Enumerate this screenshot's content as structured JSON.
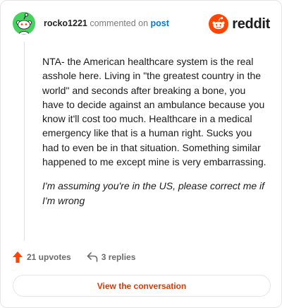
{
  "header": {
    "username": "rocko1221",
    "commented_on": "commented on",
    "post_link": "post",
    "brand_word": "reddit",
    "avatar_color": "#46d160",
    "avatar_icon": "snoo-avatar-icon",
    "brand_icon": "reddit-snoo-icon",
    "brand_color": "#ff4500"
  },
  "comment": {
    "paragraphs": [
      "NTA- the American healthcare system is the real asshole here. Living in \"the greatest country in the world\" and seconds after breaking a bone, you have to decide against an ambulance because you know it'll cost too much. Healthcare in a medical emergency like that is a human right. Sucks you had to even be in that situation. Something similar happened to me except mine is very embarrassing.",
      "I'm assuming you're in the US, please correct me if I'm wrong"
    ]
  },
  "footer": {
    "upvotes": "21 upvotes",
    "upvote_icon": "upvote-arrow-icon",
    "upvote_color": "#ff4500",
    "replies": "3 replies",
    "reply_icon": "reply-arrow-icon",
    "view_button": "View the conversation",
    "view_button_color": "#d93a00"
  }
}
